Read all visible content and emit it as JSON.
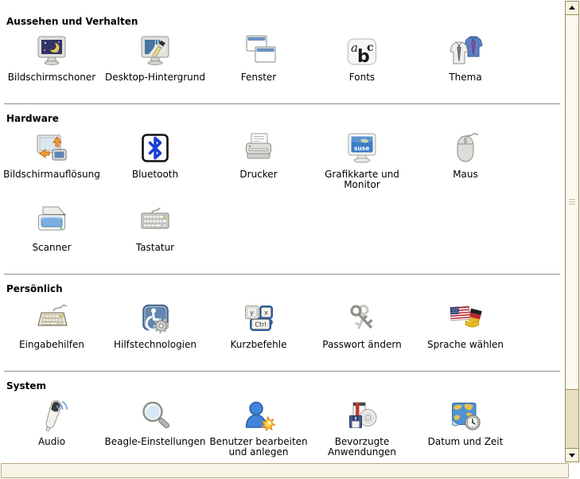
{
  "window": {
    "background": "#ffffff"
  },
  "sections": [
    {
      "title": "Aussehen und Verhalten",
      "items": [
        {
          "label": "Bildschirmschoner",
          "icon": "screensaver-icon"
        },
        {
          "label": "Desktop-Hintergrund",
          "icon": "desktop-background-icon"
        },
        {
          "label": "Fenster",
          "icon": "windows-icon"
        },
        {
          "label": "Fonts",
          "icon": "fonts-icon"
        },
        {
          "label": "Thema",
          "icon": "theme-shirts-icon"
        }
      ]
    },
    {
      "title": "Hardware",
      "items": [
        {
          "label": "Bildschirmauflösung",
          "icon": "screen-resolution-icon"
        },
        {
          "label": "Bluetooth",
          "icon": "bluetooth-icon"
        },
        {
          "label": "Drucker",
          "icon": "printer-icon"
        },
        {
          "label": "Grafikkarte und Monitor",
          "icon": "suse-monitor-icon"
        },
        {
          "label": "Maus",
          "icon": "mouse-icon"
        },
        {
          "label": "Scanner",
          "icon": "scanner-icon"
        },
        {
          "label": "Tastatur",
          "icon": "keyboard-icon"
        }
      ]
    },
    {
      "title": "Persönlich",
      "items": [
        {
          "label": "Eingabehilfen",
          "icon": "accessible-keyboard-icon"
        },
        {
          "label": "Hilfstechnologien",
          "icon": "assistive-technology-icon"
        },
        {
          "label": "Kurzbefehle",
          "icon": "keyboard-shortcuts-icon"
        },
        {
          "label": "Passwort ändern",
          "icon": "password-keys-icon"
        },
        {
          "label": "Sprache wählen",
          "icon": "language-flags-icon"
        }
      ]
    },
    {
      "title": "System",
      "items": [
        {
          "label": "Audio",
          "icon": "audio-speaker-icon"
        },
        {
          "label": "Beagle-Einstellungen",
          "icon": "search-magnifier-icon"
        },
        {
          "label": "Benutzer bearbeiten und anlegen",
          "icon": "user-account-icon"
        },
        {
          "label": "Bevorzugte Anwendungen",
          "icon": "preferred-applications-icon"
        },
        {
          "label": "Datum und Zeit",
          "icon": "date-time-icon"
        }
      ]
    }
  ],
  "scrollbar": {
    "up_icon": "scroll-up-icon",
    "down_icon": "scroll-down-icon",
    "thumb_grip_icon": "thumb-grip-icon"
  },
  "statusbar": {
    "text": ""
  },
  "colors": {
    "accent_blue": "#2e5b9e",
    "separator": "#8c8c8c",
    "statusbar_bg": "#f9f5e6",
    "statusbar_border": "#b9aa7e",
    "scrollbar_trough": "#e8dec2",
    "scrollbar_thumb": "#fcf9f0",
    "scrollbar_border": "#9a8c58"
  }
}
